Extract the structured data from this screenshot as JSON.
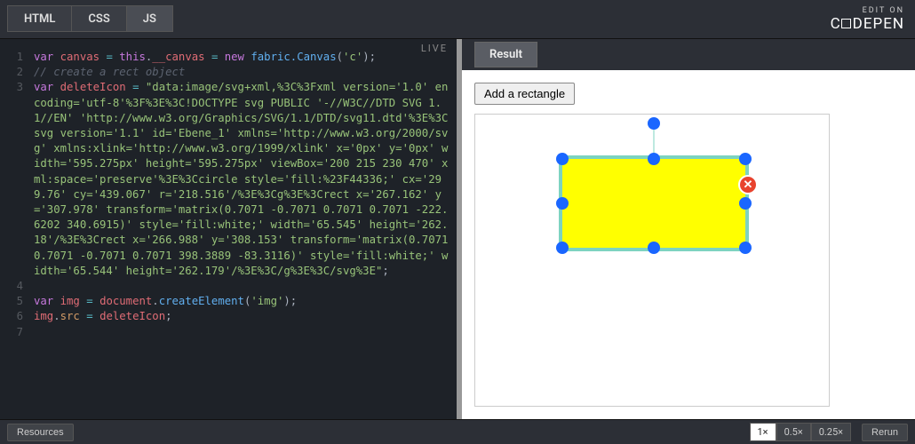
{
  "header": {
    "tabs": [
      "HTML",
      "CSS",
      "JS"
    ],
    "active_tab": "JS",
    "brand_top": "EDIT ON",
    "brand_name": "C DEPEN"
  },
  "editor": {
    "live_label": "LIVE",
    "lines": [
      {
        "n": "1",
        "html": "<span class='tok-kw'>var</span> <span class='tok-var'>canvas</span> <span class='tok-op'>=</span> <span class='tok-kw'>this</span>.<span class='tok-var'>__canvas</span> <span class='tok-op'>=</span> <span class='tok-kw'>new</span> <span class='tok-fn'>fabric.Canvas</span>(<span class='tok-str'>'c'</span>);"
      },
      {
        "n": "2",
        "html": "<span class='tok-cmt'>// create a rect object</span>"
      },
      {
        "n": "3",
        "html": "<span class='tok-kw'>var</span> <span class='tok-var'>deleteIcon</span> <span class='tok-op'>=</span> <span class='tok-str'>\"data:image/svg+xml,%3C%3Fxml version='1.0' encoding='utf-8'%3F%3E%3C!DOCTYPE svg PUBLIC '-//W3C//DTD SVG 1.1//EN' 'http://www.w3.org/Graphics/SVG/1.1/DTD/svg11.dtd'%3E%3Csvg version='1.1' id='Ebene_1' xmlns='http://www.w3.org/2000/svg' xmlns:xlink='http://www.w3.org/1999/xlink' x='0px' y='0px' width='595.275px' height='595.275px' viewBox='200 215 230 470' xml:space='preserve'%3E%3Ccircle style='fill:%23F44336;' cx='299.76' cy='439.067' r='218.516'/%3E%3Cg%3E%3Crect x='267.162' y='307.978' transform='matrix(0.7071 -0.7071 0.7071 0.7071 -222.6202 340.6915)' style='fill:white;' width='65.545' height='262.18'/%3E%3Crect x='266.988' y='308.153' transform='matrix(0.7071 0.7071 -0.7071 0.7071 398.3889 -83.3116)' style='fill:white;' width='65.544' height='262.179'/%3E%3C/g%3E%3C/svg%3E\"</span>;"
      },
      {
        "n": "4",
        "html": ""
      },
      {
        "n": "5",
        "html": "<span class='tok-kw'>var</span> <span class='tok-var'>img</span> <span class='tok-op'>=</span> <span class='tok-var'>document</span>.<span class='tok-fn'>createElement</span>(<span class='tok-str'>'img'</span>);"
      },
      {
        "n": "6",
        "html": "<span class='tok-var'>img</span>.<span class='tok-prop'>src</span> <span class='tok-op'>=</span> <span class='tok-var'>deleteIcon</span>;"
      },
      {
        "n": "7",
        "html": ""
      }
    ]
  },
  "result": {
    "tab_label": "Result",
    "button_label": "Add a rectangle",
    "rect": {
      "fill": "#ffff00",
      "border": "#7dd3c0",
      "handle_color": "#1a66ff"
    }
  },
  "footer": {
    "resources_label": "Resources",
    "zoom_levels": [
      "1×",
      "0.5×",
      "0.25×"
    ],
    "active_zoom": "1×",
    "rerun_label": "Rerun"
  }
}
